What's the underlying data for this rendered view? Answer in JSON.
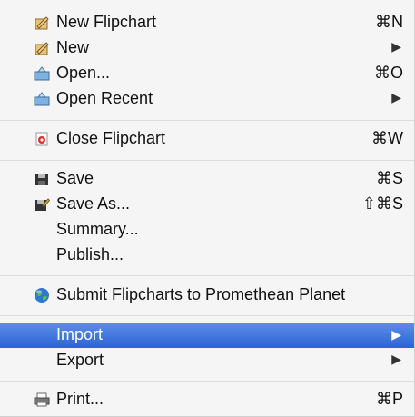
{
  "menu": {
    "new_flipchart": {
      "label": "New Flipchart",
      "shortcut": "⌘N"
    },
    "new": {
      "label": "New",
      "arrow": "▶"
    },
    "open": {
      "label": "Open...",
      "shortcut": "⌘O"
    },
    "open_recent": {
      "label": "Open Recent",
      "arrow": "▶"
    },
    "close_flipchart": {
      "label": "Close Flipchart",
      "shortcut": "⌘W"
    },
    "save": {
      "label": "Save",
      "shortcut": "⌘S"
    },
    "save_as": {
      "label": "Save As...",
      "shortcut": "⇧⌘S"
    },
    "summary": {
      "label": "Summary..."
    },
    "publish": {
      "label": "Publish..."
    },
    "submit": {
      "label": "Submit Flipcharts to Promethean Planet"
    },
    "import": {
      "label": "Import",
      "arrow": "▶"
    },
    "export": {
      "label": "Export",
      "arrow": "▶"
    },
    "print": {
      "label": "Print...",
      "shortcut": "⌘P"
    }
  },
  "colors": {
    "highlight": "#2c63d6",
    "background": "#f5f5f5"
  }
}
